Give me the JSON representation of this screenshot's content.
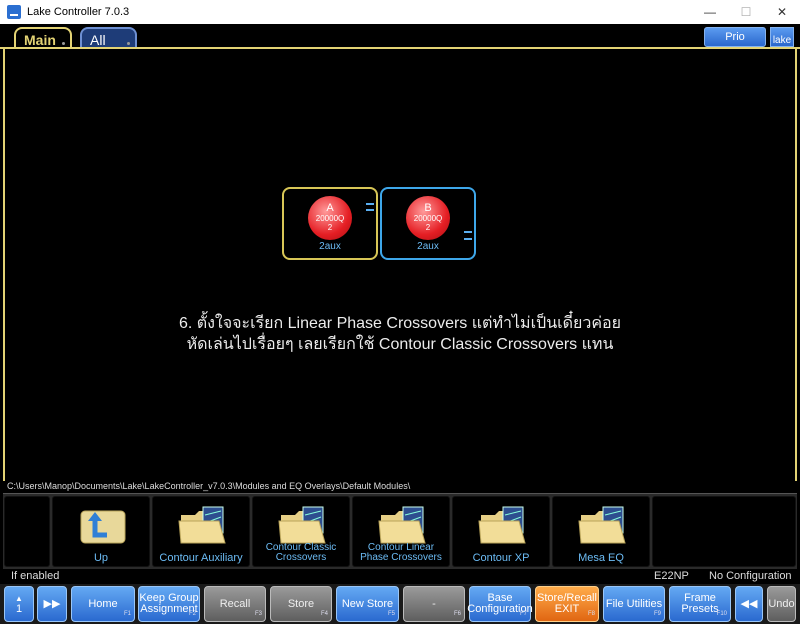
{
  "window": {
    "title": "Lake Controller 7.0.3",
    "minimize": "—",
    "maximize": "☐",
    "close": "✕"
  },
  "tabs": {
    "main": "Main",
    "all": "All"
  },
  "header": {
    "prio": "Prio",
    "lake_logo": "lake"
  },
  "modules": [
    {
      "letter": "A",
      "model": "20000Q",
      "num": "2",
      "name": "2aux"
    },
    {
      "letter": "B",
      "model": "20000Q",
      "num": "2",
      "name": "2aux"
    }
  ],
  "message": {
    "line1": "6. ตั้งใจจะเรียก Linear Phase Crossovers แต่ทำไม่เป็นเดี๋ยวค่อย",
    "line2": "หัดเล่นไปเรื่อยๆ เลยเรียกใช้ Contour Classic Crossovers แทน"
  },
  "path": "C:\\Users\\Manop\\Documents\\Lake\\LakeController_v7.0.3\\Modules and EQ Overlays\\Default Modules\\",
  "folders": [
    {
      "label": "Up"
    },
    {
      "label": "Contour Auxiliary"
    },
    {
      "label": "Contour Classic Crossovers"
    },
    {
      "label": "Contour Linear Phase Crossovers"
    },
    {
      "label": "Contour XP"
    },
    {
      "label": "Mesa EQ"
    }
  ],
  "status": {
    "left": "If enabled",
    "device": "E22NP",
    "config": "No Configuration"
  },
  "fkeys": {
    "page_num": "1",
    "home": "Home",
    "home_fn": "F1",
    "keep_group": "Keep Group Assignment",
    "keep_group_fn": "F2",
    "recall": "Recall",
    "recall_fn": "F3",
    "store": "Store",
    "store_fn": "F4",
    "new_store": "New Store",
    "new_store_fn": "F5",
    "dash": "-",
    "dash_fn": "F6",
    "base_config": "Base Configuration",
    "base_config_fn": "F7",
    "store_recall_exit": "Store/Recall EXIT",
    "store_recall_exit_fn": "F8",
    "file_utilities": "File Utilities",
    "file_utilities_fn": "F9",
    "frame_presets": "Frame Presets",
    "frame_presets_fn": "F10",
    "undo": "Undo"
  },
  "colors": {
    "tab_gold": "#e3d374",
    "module_a": "#d8c656",
    "module_b": "#3ea7ea",
    "accent_blue": "#2a69cf",
    "exit_orange": "#e06612"
  }
}
